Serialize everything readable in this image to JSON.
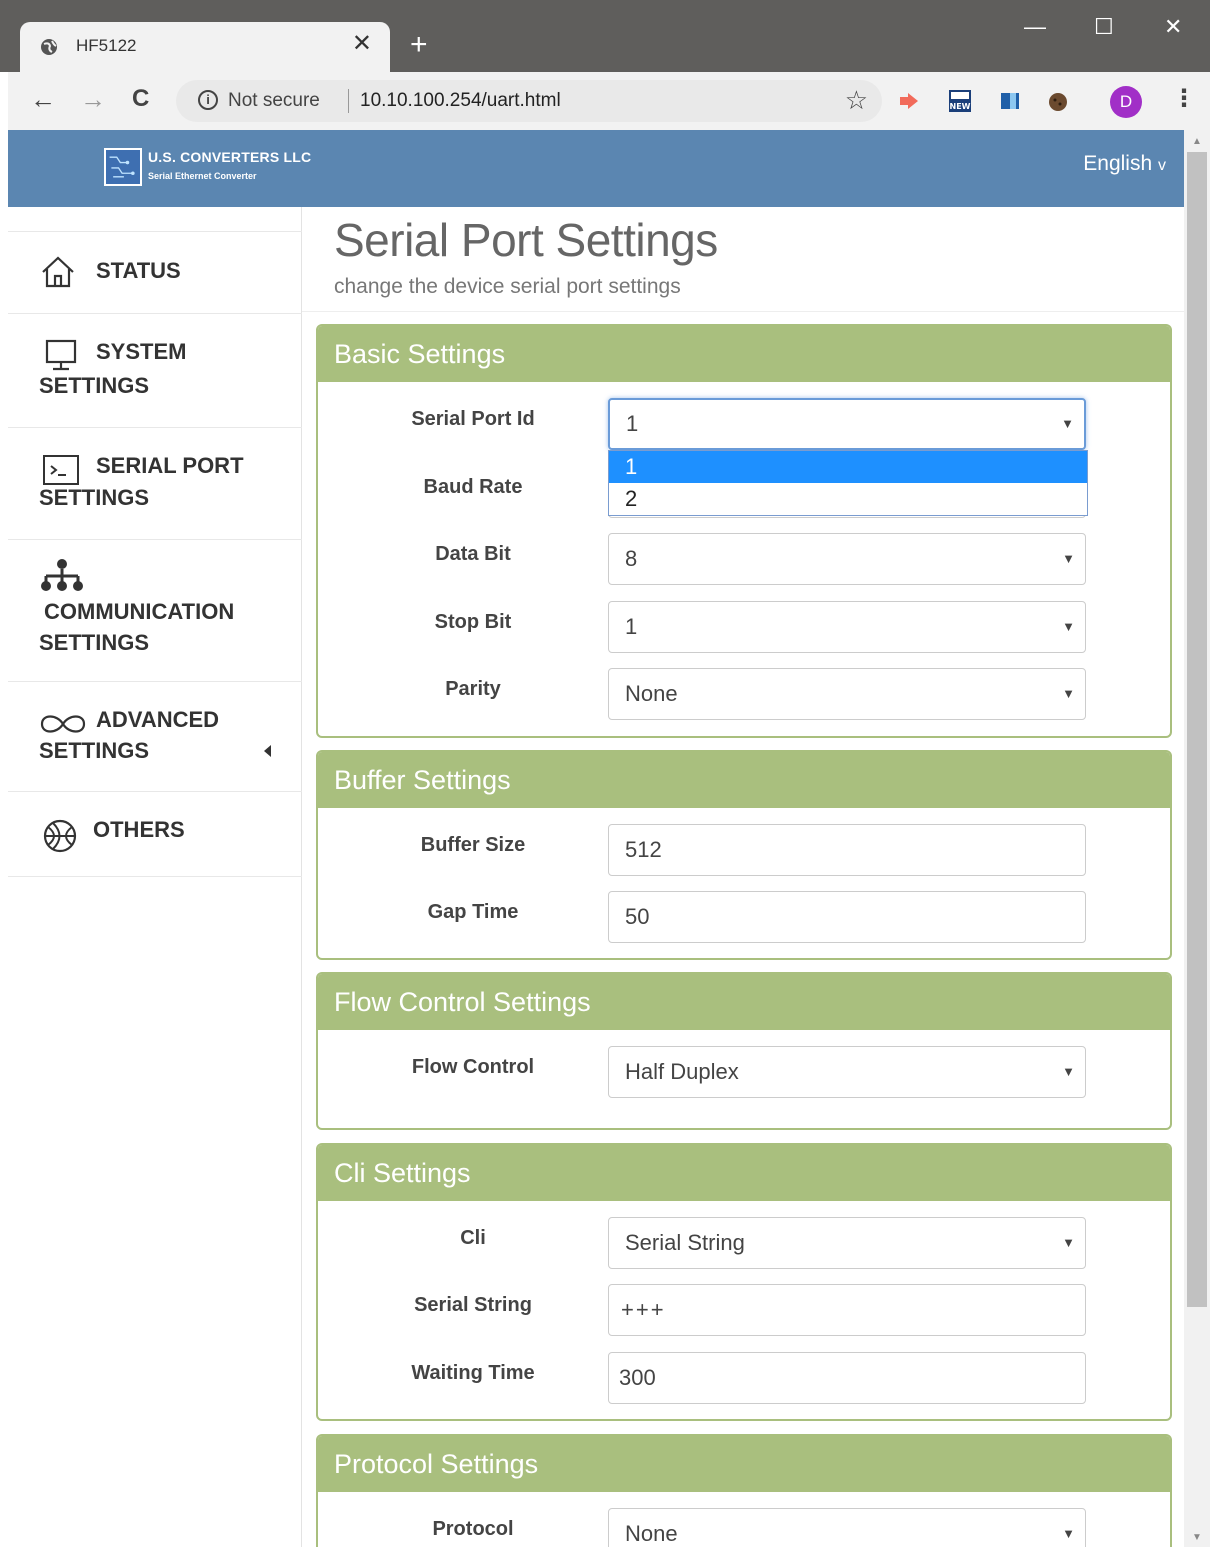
{
  "browser": {
    "tab_title": "HF5122",
    "tab_close": "✕",
    "new_tab": "+",
    "win_min": "—",
    "win_max": "☐",
    "win_close": "✕",
    "back": "←",
    "forward": "→",
    "reload": "C",
    "info": "i",
    "not_secure": "Not secure",
    "url": "10.10.100.254/uart.html",
    "star": "☆",
    "profile_initial": "D",
    "menu": "⋮"
  },
  "header": {
    "logo_text": "U.S. CONVERTERS LLC",
    "logo_sub": "Serial Ethernet Converter",
    "language": "English",
    "language_caret": "v"
  },
  "sidebar": {
    "items": [
      {
        "label": "STATUS",
        "icon": "home-icon"
      },
      {
        "label": "SYSTEM SETTINGS",
        "icon": "monitor-icon"
      },
      {
        "label": "SERIAL PORT SETTINGS",
        "icon": "terminal-icon"
      },
      {
        "label": "COMMUNICATION SETTINGS",
        "icon": "network-icon"
      },
      {
        "label": "ADVANCED SETTINGS",
        "icon": "infinity-icon"
      },
      {
        "label": "OTHERS",
        "icon": "basketball-icon"
      }
    ],
    "labels": {
      "status": "STATUS",
      "system_1": "SYSTEM",
      "system_2": "SETTINGS",
      "serial_1": "SERIAL PORT",
      "serial_2": "SETTINGS",
      "comm_1": "COMMUNICATION",
      "comm_2": "SETTINGS",
      "adv_1": "ADVANCED",
      "adv_2": "SETTINGS",
      "others": "OTHERS"
    }
  },
  "main": {
    "title": "Serial Port Settings",
    "subtitle": "change the device serial port settings",
    "basic": {
      "heading": "Basic Settings",
      "serial_port_id_label": "Serial Port Id",
      "serial_port_id_value": "1",
      "serial_port_id_options": [
        "1",
        "2"
      ],
      "baud_rate_label": "Baud Rate",
      "data_bit_label": "Data Bit",
      "data_bit_value": "8",
      "stop_bit_label": "Stop Bit",
      "stop_bit_value": "1",
      "parity_label": "Parity",
      "parity_value": "None"
    },
    "buffer": {
      "heading": "Buffer Settings",
      "buffer_size_label": "Buffer Size",
      "buffer_size_value": "512",
      "gap_time_label": "Gap Time",
      "gap_time_value": "50"
    },
    "flow": {
      "heading": "Flow Control Settings",
      "flow_control_label": "Flow Control",
      "flow_control_value": "Half Duplex"
    },
    "cli": {
      "heading": "Cli Settings",
      "cli_label": "Cli",
      "cli_value": "Serial String",
      "serial_string_label": "Serial String",
      "serial_string_value": "+++",
      "waiting_time_label": "Waiting Time",
      "waiting_time_value": "300"
    },
    "protocol": {
      "heading": "Protocol Settings",
      "protocol_label": "Protocol",
      "protocol_value": "None"
    },
    "select_arrow": "▼"
  },
  "colors": {
    "header_blue": "#5b86b1",
    "panel_green": "#a9bf7e",
    "dropdown_highlight": "#1e90ff",
    "profile_purple": "#a12fc7"
  }
}
